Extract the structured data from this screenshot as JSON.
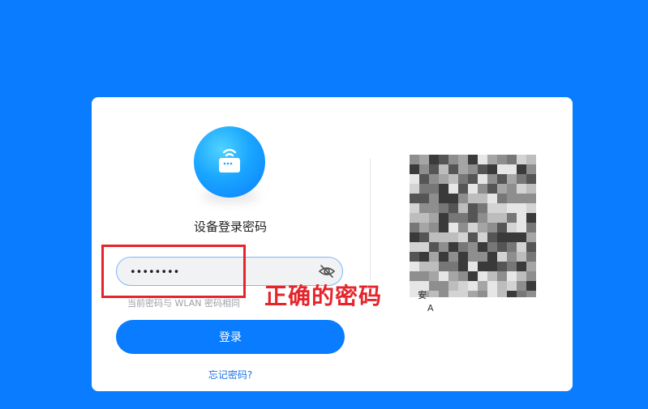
{
  "login": {
    "title": "设备登录密码",
    "password_value": "••••••••",
    "password_toggle_icon": "eye-off-icon",
    "hint": "当前密码与 WLAN 密码相同",
    "login_button": "登录",
    "forgot_link": "忘记密码?"
  },
  "qr": {
    "caption_line1": "安",
    "caption_line2": "A"
  },
  "annotation": {
    "label": "正确的密码",
    "color": "#e5242b"
  },
  "colors": {
    "background": "#0a7cff",
    "accent": "#0a7cff",
    "link": "#1a73e8"
  }
}
